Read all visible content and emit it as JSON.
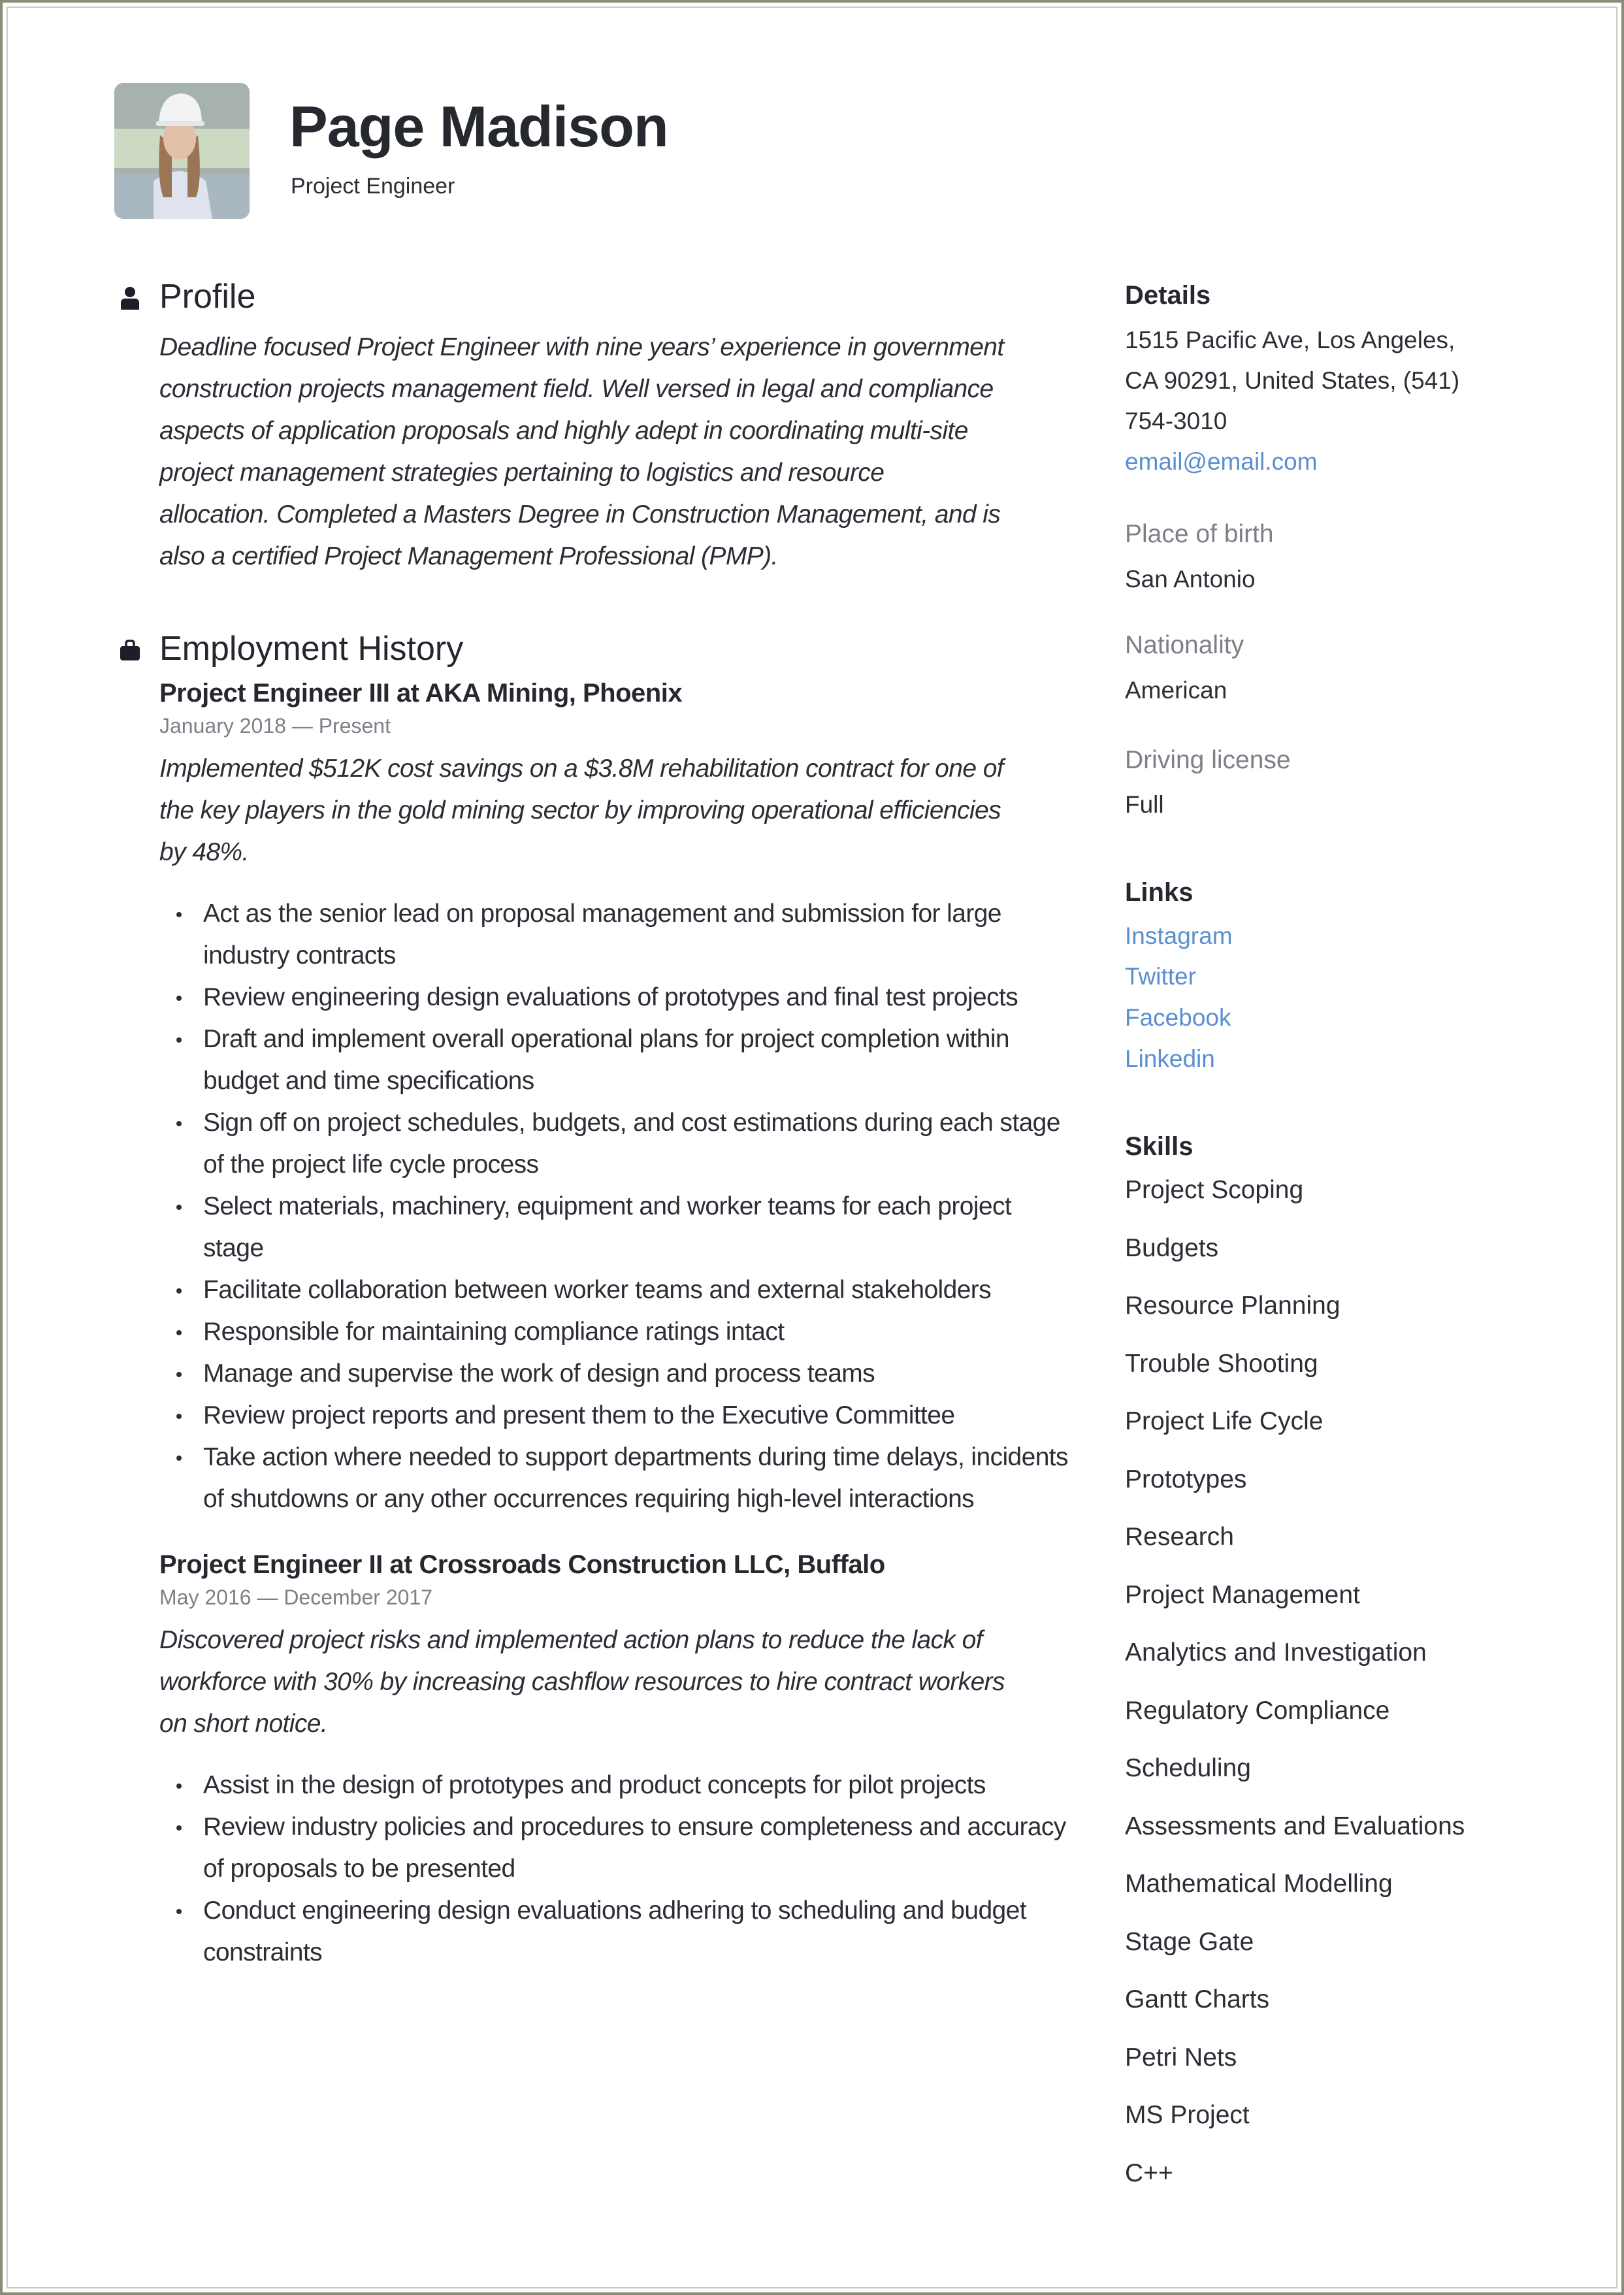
{
  "header": {
    "name": "Page Madison",
    "title": "Project Engineer",
    "photo_alt": "profile-photo"
  },
  "profile": {
    "heading": "Profile",
    "icon": "person-icon",
    "lines": [
      "Deadline focused Project Engineer with nine years’ experience in government",
      "construction projects management field. Well versed in legal and compliance",
      "aspects of application proposals and highly adept in coordinating multi-site",
      "project management strategies pertaining to logistics and resource",
      "allocation. Completed a Masters Degree in Construction Management, and is",
      "also a certified Project Management Professional (PMP)."
    ]
  },
  "employment": {
    "heading": "Employment History",
    "icon": "briefcase-icon",
    "jobs": [
      {
        "title": "Project Engineer III at  AKA Mining, Phoenix",
        "dates": "January 2018 — Present",
        "summary_lines": [
          "Implemented $512K cost savings on a $3.8M rehabilitation contract for one of",
          "the key players in the gold mining sector by improving operational efficiencies",
          "by 48%."
        ],
        "bullets": [
          "Act as the senior lead on proposal management and submission for large industry contracts",
          "Review engineering design evaluations of prototypes and final test projects",
          "Draft and implement overall operational plans for project completion within budget and time specifications",
          "Sign off on project schedules, budgets, and cost estimations during each stage of the project life cycle process",
          "Select materials, machinery, equipment and worker teams for each project stage",
          "Facilitate collaboration between worker teams and external stakeholders",
          "Responsible for maintaining compliance ratings intact",
          "Manage and supervise the work of design and process teams",
          "Review project reports and present them to the Executive Committee",
          "Take action where needed to support departments during time delays, incidents of shutdowns or any other occurrences requiring high-level interactions"
        ]
      },
      {
        "title": "Project Engineer II at  Crossroads Construction LLC, Buffalo",
        "dates": "May 2016 — December 2017",
        "summary_lines": [
          "Discovered project risks and implemented action plans to reduce the lack of",
          "workforce with 30% by increasing cashflow resources to hire contract workers",
          "on short notice."
        ],
        "bullets": [
          "Assist in the design of prototypes and product concepts for pilot projects",
          "Review industry policies and procedures to ensure completeness and accuracy of proposals to be presented",
          "Conduct engineering design evaluations adhering to scheduling and budget constraints"
        ]
      }
    ]
  },
  "details": {
    "heading": "Details",
    "address_lines": [
      "1515 Pacific Ave, Los Angeles,",
      "CA 90291, United States, (541)",
      "754-3010"
    ],
    "email": "email@email.com",
    "fields": [
      {
        "label": "Place of birth",
        "value": "San Antonio"
      },
      {
        "label": "Nationality",
        "value": "American"
      },
      {
        "label": "Driving license",
        "value": "Full"
      }
    ]
  },
  "links": {
    "heading": "Links",
    "items": [
      "Instagram",
      "Twitter",
      "Facebook",
      "Linkedin"
    ]
  },
  "skills": {
    "heading": "Skills",
    "items": [
      "Project Scoping",
      "Budgets",
      "Resource Planning",
      "Trouble Shooting",
      "Project Life Cycle",
      "Prototypes",
      "Research",
      "Project Management",
      "Analytics and Investigation",
      "Regulatory Compliance",
      "Scheduling",
      "Assessments and Evaluations",
      "Mathematical Modelling",
      "Stage Gate",
      "Gantt Charts",
      "Petri Nets",
      "MS Project",
      "C++"
    ]
  },
  "colors": {
    "text": "#24272e",
    "muted": "#7d8087",
    "link": "#5a8fd0",
    "border": "#8a8d78"
  }
}
